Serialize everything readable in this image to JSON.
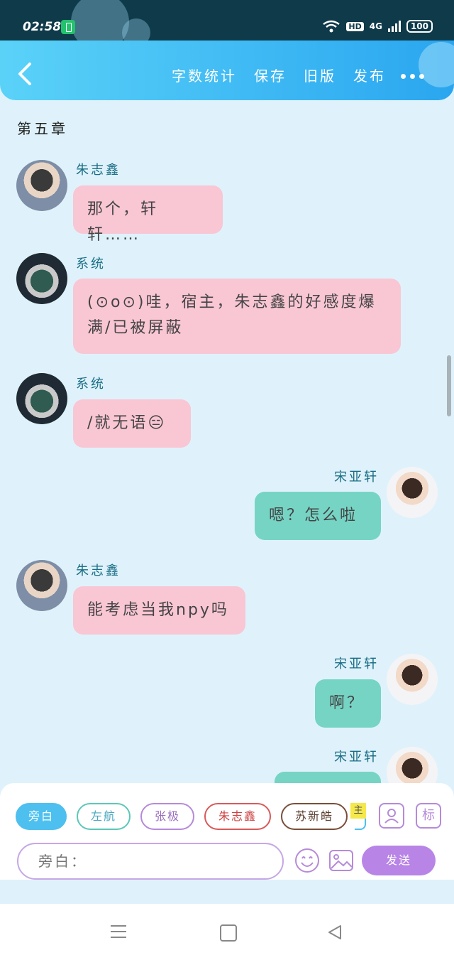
{
  "status": {
    "time": "02:58",
    "hd": "HD",
    "network": "4G",
    "battery": "100"
  },
  "toolbar": {
    "actions": [
      "字数统计",
      "保存",
      "旧版",
      "发布"
    ]
  },
  "chapter_title": "第五章",
  "messages": [
    {
      "speaker": "朱志鑫",
      "text": "那个，轩轩……",
      "side": "left"
    },
    {
      "speaker": "系统",
      "text": "(⊙o⊙)哇，宿主，朱志鑫的好感度爆满/已被屏蔽",
      "side": "left"
    },
    {
      "speaker": "系统",
      "text": "/就无语😑",
      "side": "left"
    },
    {
      "speaker": "宋亚轩",
      "text": "嗯？怎么啦",
      "side": "right"
    },
    {
      "speaker": "朱志鑫",
      "text": "能考虑当我npy吗",
      "side": "left"
    },
    {
      "speaker": "宋亚轩",
      "text": "啊？",
      "side": "right"
    },
    {
      "speaker": "宋亚轩",
      "text": "",
      "side": "right"
    }
  ],
  "characters": [
    "旁白",
    "左航",
    "张极",
    "朱志鑫",
    "苏新皓"
  ],
  "host_tag": "主",
  "tag_button": "标",
  "input": {
    "placeholder": "旁白："
  },
  "send_label": "发送",
  "colors": {
    "pink_bubble": "#f9c6d4",
    "teal_bubble": "#76d4c5",
    "accent": "#b884e6",
    "header": "#2aa6f0"
  }
}
